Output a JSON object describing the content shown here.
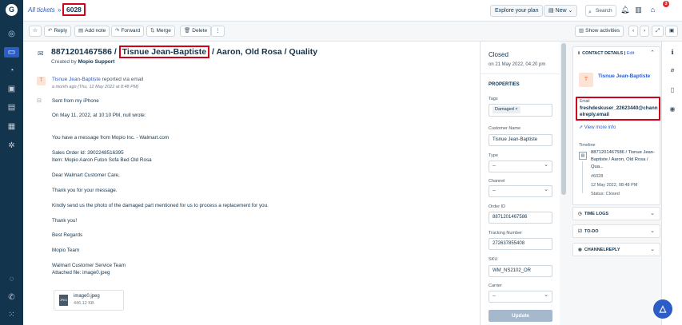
{
  "app": {
    "logo": "G",
    "icons": [
      "dashboard-icon",
      "tickets-icon",
      "contacts-icon",
      "groups-icon",
      "knowledge-base-icon",
      "reports-icon",
      "settings-icon",
      "chat-icon",
      "phone-icon",
      "apps-icon"
    ]
  },
  "topbar": {
    "breadcrumb": "All tickets",
    "separator": "»",
    "ticket_id": "6028",
    "explore_label": "Explore your plan",
    "new_label": "New",
    "search_placeholder": "Search",
    "notification_count": "3",
    "avatar_initial": "v"
  },
  "actions": {
    "reply": "Reply",
    "add_note": "Add note",
    "forward": "Forward",
    "merge": "Merge",
    "delete": "Delete",
    "more": "⋮",
    "show_activities": "Show activities"
  },
  "ticket": {
    "subject_prefix": "8871201467586 /",
    "subject_name": "Tisnue Jean-Baptiste",
    "subject_suffix": "/ Aaron, Old Rosa / Quality",
    "created_by_label": "Created by",
    "created_by": "Mopio Support",
    "reporter_name": "Tisnue Jean-Baptiste",
    "reporter_text": "reported via email",
    "reporter_time": "a month ago (Thu, 12 May 2022 at 8:48 PM)",
    "reporter_initial": "T",
    "body": [
      "Sent from my iPhone",
      "On May 11, 2022, at 10:10 PM, null wrote:",
      "You have a message from Mopio Inc. - Walmart.com",
      "Sales Order Id: 3902248516395",
      "Item: Mopio Aaron Futon Sofa Bed Old Rosa",
      "Dear Walmart Customer Care,",
      "Thank you for your message.",
      "Kindly send us the photo of the damaged part mentioned for us to process a replacement for you.",
      "Thank you!",
      "Best Regards",
      "Mopio Team",
      "Walmart Customer Service Team",
      "Attached file: image0.jpeg"
    ],
    "attachment": {
      "name": "image0.jpeg",
      "size": "446.12 KB",
      "type": "JPEG"
    }
  },
  "properties": {
    "status": "Closed",
    "status_date": "on 21 May 2022, 04:20 pm",
    "heading": "PROPERTIES",
    "tags_label": "Tags",
    "tag": "Damaged",
    "customer_name_label": "Customer Name",
    "customer_name": "Tisnue Jean-Baptiste",
    "type_label": "Type",
    "type_value": "--",
    "channel_label": "Channel",
    "channel_value": "--",
    "order_id_label": "Order ID",
    "order_id": "8871201467586",
    "tracking_label": "Tracking Number",
    "tracking": "272637855408",
    "sku_label": "SKU",
    "sku": "WM_NS2102_OR",
    "carrier_label": "Carrier",
    "carrier_value": "--",
    "update_label": "Update"
  },
  "contact": {
    "heading": "CONTACT DETAILS",
    "edit": "Edit",
    "name": "Tisnue Jean-Baptiste",
    "initial": "T",
    "email_label": "Email",
    "email": "freshdeskuser_22623440@channelreply.email",
    "view_more": "View more info",
    "timeline_label": "Timeline",
    "timeline_lines": [
      "8871201467586 / Tisnue Jean-",
      "Baptiste / Aaron, Old Rosa /",
      "Qua..."
    ],
    "timeline_id": "#6028",
    "timeline_date": "12 May 2022, 08:48 PM",
    "timeline_status": "Status: Closed"
  },
  "side_sections": {
    "time_logs": "TIME LOGS",
    "todo": "TO-DO",
    "channelreply": "CHANNELREPLY"
  }
}
